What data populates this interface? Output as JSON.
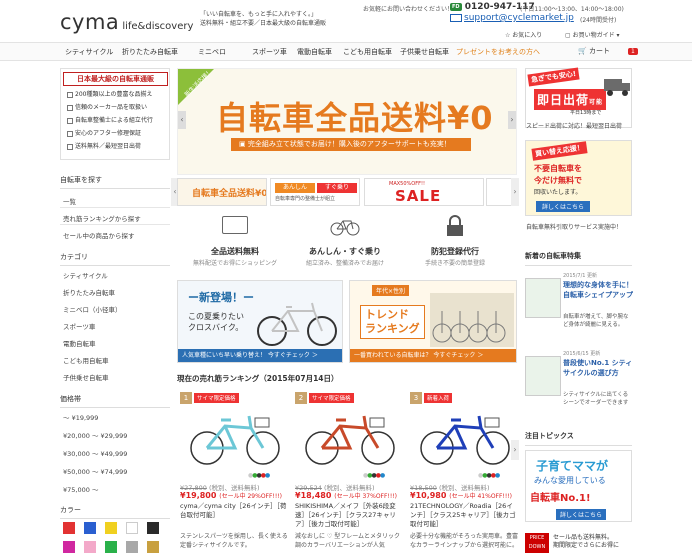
{
  "header": {
    "logo": "cyma",
    "logo_sub": "life&discovery",
    "tagline_1": "「いい自転車を、もっと手に入れやすく。」",
    "tagline_2": "送料無料・組立不要／日本最大級の自転車通販",
    "contact_label": "お気軽にお問い合わせください！",
    "phone": "0120-947-117",
    "phone_hours": "(平日11:00～13:00、14:00～18:00)",
    "email": "support@cyclemarket.jp",
    "email_hours": "(24時間受付)",
    "favorites": "お気に入り",
    "guide": "お買い物ガイド"
  },
  "nav": {
    "items": [
      "シティサイクル",
      "折りたたみ自転車",
      "ミニベロ",
      "スポーツ車",
      "電動自転車",
      "こども用自転車",
      "子供乗せ自転車",
      "プレゼントをお考えの方へ"
    ],
    "cart_label": "カート",
    "cart_count": "1"
  },
  "left": {
    "rank_title": "日本最大級の自転車通販",
    "features": [
      "200種類以上の豊富な品揃え",
      "信頼のメーカー品を取扱い",
      "自転車整備士による組立代行",
      "安心のアフター修理保証",
      "送料無料／最短翌日出荷"
    ],
    "search_head": "自転車を探す",
    "search_items": [
      "一覧",
      "売れ筋ランキングから探す",
      "セール中の商品から探す"
    ],
    "category_head": "カテゴリ",
    "categories": [
      "シティサイクル",
      "折りたたみ自転車",
      "ミニベロ（小径車）",
      "スポーツ車",
      "電動自転車",
      "こども用自転車",
      "子供乗せ自転車"
    ],
    "price_head": "価格帯",
    "prices": [
      "～ ¥19,999",
      "¥20,000 ～ ¥29,999",
      "¥30,000 ～ ¥49,999",
      "¥50,000 ～ ¥74,999",
      "¥75,000 ～"
    ],
    "color_head": "カラー",
    "colors": [
      "#e23232",
      "#2a5fd0",
      "#f0d020",
      "#ffffff",
      "#2a2a2a",
      "#d028a0",
      "#f3a9c9",
      "#2ab14a",
      "#a8a8a8",
      "#c8a040"
    ]
  },
  "hero": {
    "ribbon": "新生活応援！",
    "title": "自転車全品送料¥0",
    "bar": "完全組み立て状態でお届け！購入後のアフターサポートも充実！"
  },
  "thumbs": {
    "t1": "自転車全品送料¥0",
    "t2a": "あんしん",
    "t2b": "すぐ乗り",
    "t2c": "自転車専門の整備士が組立",
    "t3a": "MAX50%OFF!!",
    "t3b": "SALE"
  },
  "features_row": [
    {
      "icon": "box-icon",
      "title": "全品送料無料",
      "sub": "無料配送でお得にショッピング"
    },
    {
      "icon": "bicycle-icon",
      "title": "あんしん・すぐ乗り",
      "sub": "組立済み、整備済みでお届け"
    },
    {
      "icon": "lock-icon",
      "title": "防犯登録代行",
      "sub": "手続き不要の簡単登録"
    }
  ],
  "banners": {
    "b1_title": "ー新登場！ー",
    "b1_text_1": "この夏乗りたい",
    "b1_text_2": "クロスバイク。",
    "b1_bar": "人気車種にいち早い乗り替え！ 今すぐチェック ＞",
    "b2_tag": "年代×性別",
    "b2_title_1": "トレンド",
    "b2_title_2": "ランキング",
    "b2_bar": "一番買われている自転車は？ 今すぐチェック ＞"
  },
  "ranking": {
    "head": "現在の売れ筋ランキング（2015年07月14日）",
    "items": [
      {
        "rank": "1",
        "label": "サイマ限定価格",
        "old": "¥27,800",
        "old_note": "(税別、送料無料)",
        "price": "¥19,800",
        "sale": "(セール中 29%OFF!!!)",
        "name": "cyma／cyma city［26インチ］［荷台取付可能］",
        "desc": "ステンレスパーツを採用し、長く使える定番シティサイクルです。",
        "color": "#6cc7d6"
      },
      {
        "rank": "2",
        "label": "サイマ限定価格",
        "old": "¥29,524",
        "old_note": "(税別、送料無料)",
        "price": "¥18,480",
        "sale": "(セール中 37%OFF!!!)",
        "name": "SHIKISHIMA／メイフ［外装6段変速］［26インチ］［クラス27キャリア］［後カゴ取付可能］",
        "desc": "減なおしに ♡ 型フレームとメタリック調のカラーバリエーションが人気",
        "color": "#c84a2a"
      },
      {
        "rank": "3",
        "label": "新着入荷",
        "old": "¥18,500",
        "old_note": "(税別、送料無料)",
        "price": "¥10,980",
        "sale": "(セール中 41%OFF!!!)",
        "name": "21TECHNOLOGY／Roadia［26インチ］［クラス25キャリア］［後カゴ取付可能］",
        "desc": "必要十分な機能がそろった実用車。豊富なカラーラインナップから選択可能に。",
        "color": "#1f3fb8"
      }
    ]
  },
  "right": {
    "r1_a": "急ぎでも安心!",
    "r1_b": "即日出荷",
    "r1_b2": "可能",
    "r1_c": "平日13時まで",
    "r1_cap": "スピード出荷に対応！最短翌日出荷",
    "r2_a": "買い替え応援！",
    "r2_b": "不要自転車を",
    "r2_b2": "今だけ無料で",
    "r2_c": "回収いたします。",
    "r2_d": "詳しくはこちら",
    "r2_cap": "自転車無料引取りサービス実施中！",
    "new_head": "新着の自転車特集",
    "news": [
      {
        "date": "2015/7/1 更新",
        "title": "理想的な身体を手に！自転車シェイプアップ",
        "sub": "自転車が増えて、脚や腕など身体が綺麗に見える。"
      },
      {
        "date": "2015/6/15 更新",
        "title": "普段使いNo.1 シティサイクルの選び方",
        "sub": "シティサイクルに出てくるシーンでオーダーできます"
      }
    ],
    "topic_head": "注目トピックス",
    "r3_a": "子育てママが",
    "r3_b": "みんな愛用している",
    "r3_c": "自転車No.1!",
    "r3_d": "詳しくはこちら",
    "pd_badge": "PRICE DOWN",
    "pd_1": "セール品も送料無料。",
    "pd_2": "期間限定でさらにお得に"
  }
}
